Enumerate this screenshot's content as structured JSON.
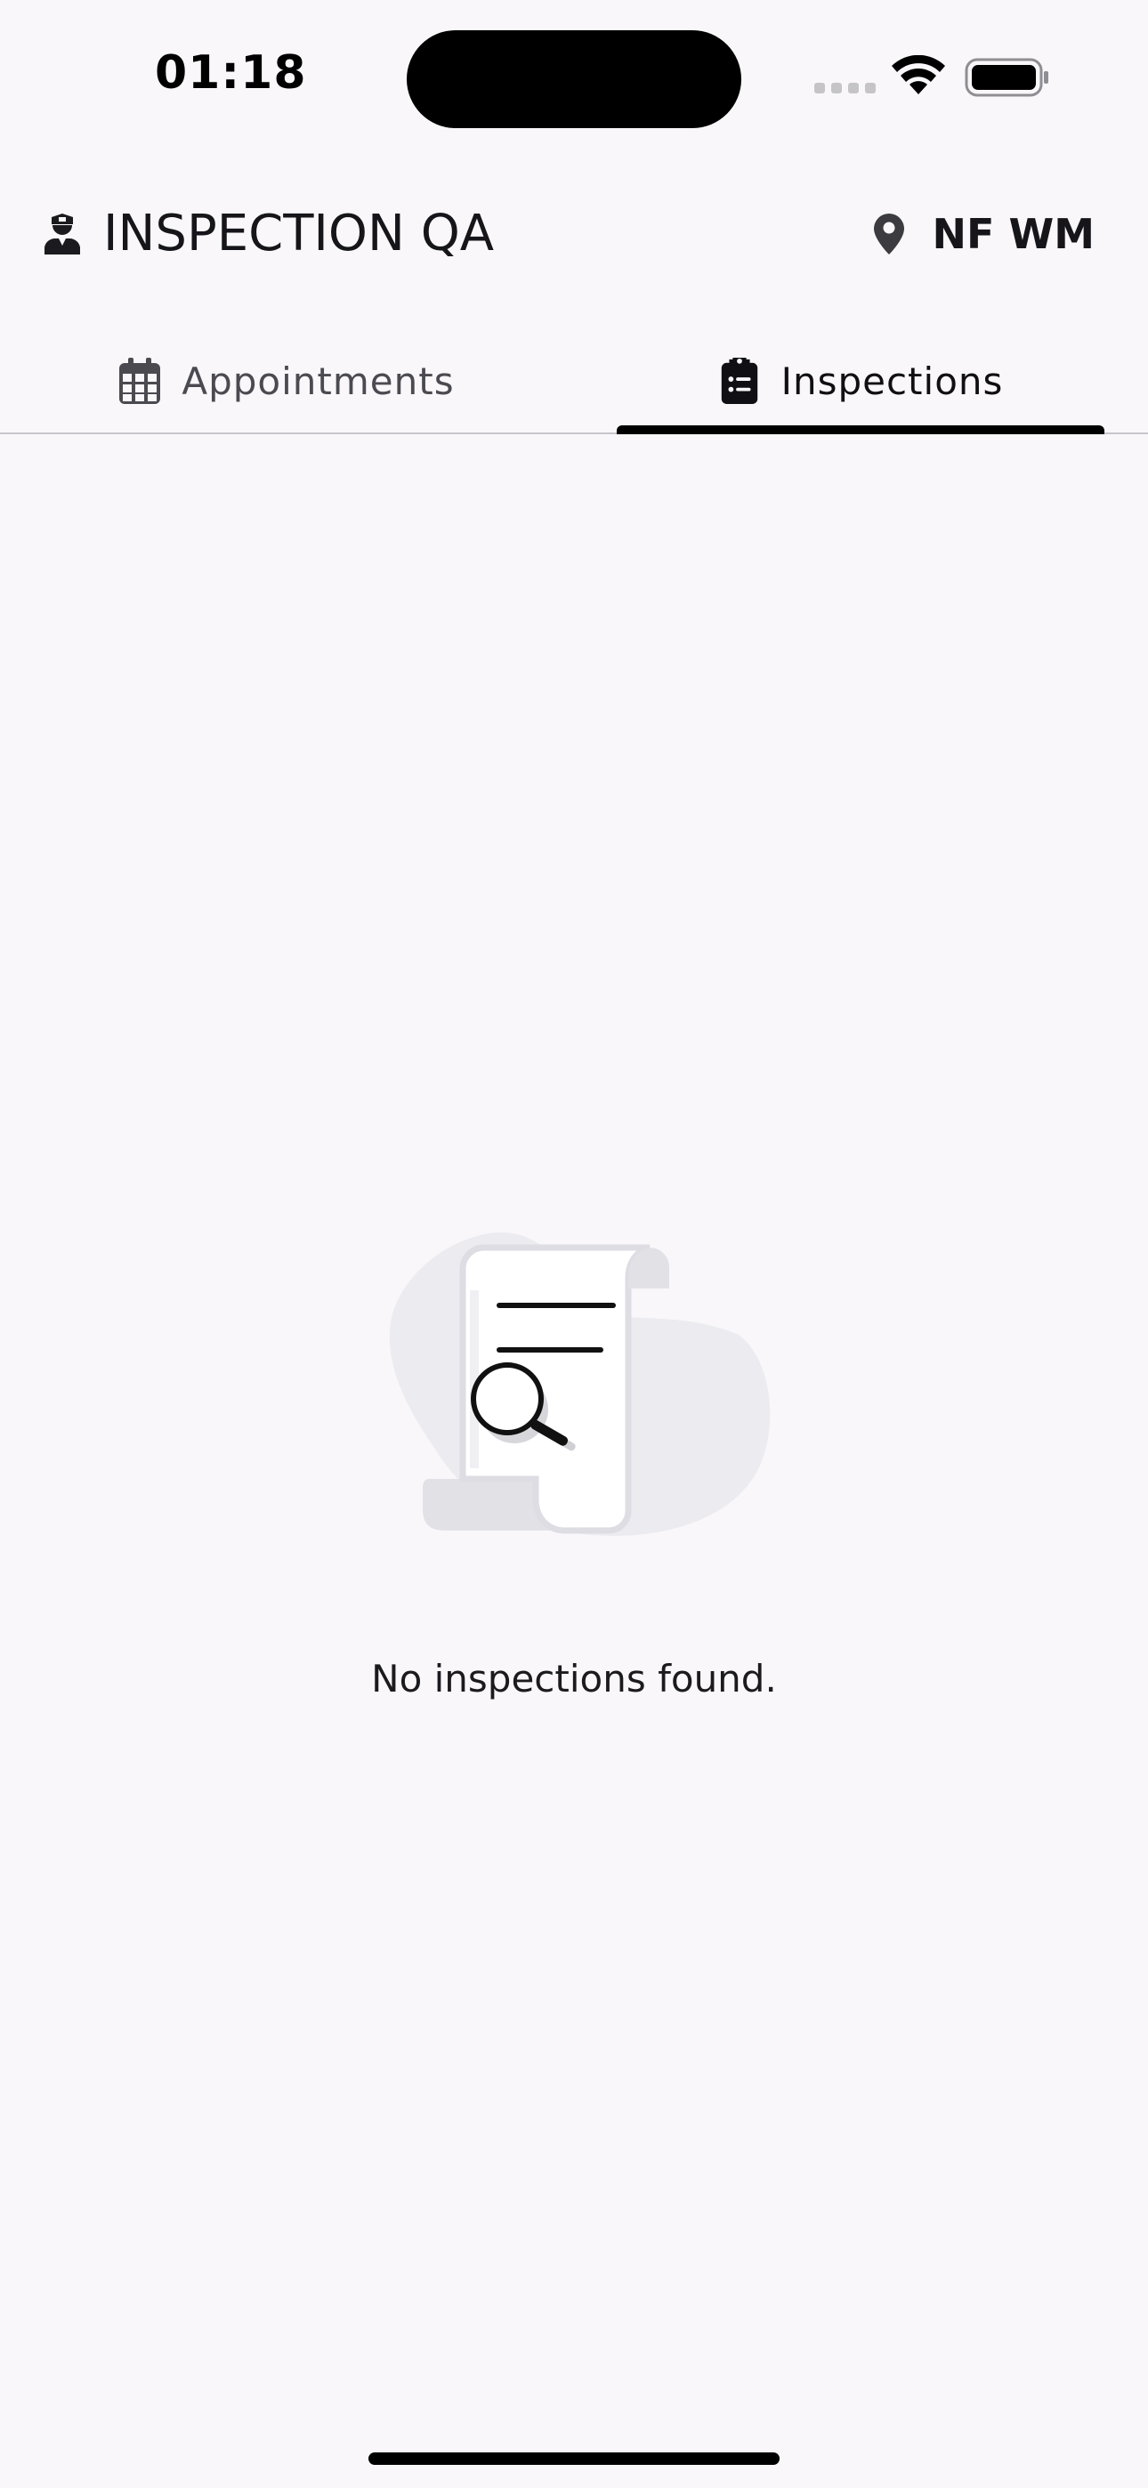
{
  "status_bar": {
    "time": "01:18"
  },
  "header": {
    "title": "INSPECTION QA",
    "title_icon": "inspector-icon",
    "location": "NF WM",
    "location_icon": "map-pin-icon"
  },
  "tabs": [
    {
      "label": "Appointments",
      "icon": "calendar-icon",
      "selected": false
    },
    {
      "label": "Inspections",
      "icon": "clipboard-list-icon",
      "selected": true
    }
  ],
  "empty_state": {
    "icon": "document-search-illustration",
    "message": "No inspections found."
  },
  "colors": {
    "background": "#f9f7fa",
    "text": "#1b1b1f",
    "tab_indicator": "#000000",
    "divider": "#c8c6cb"
  }
}
